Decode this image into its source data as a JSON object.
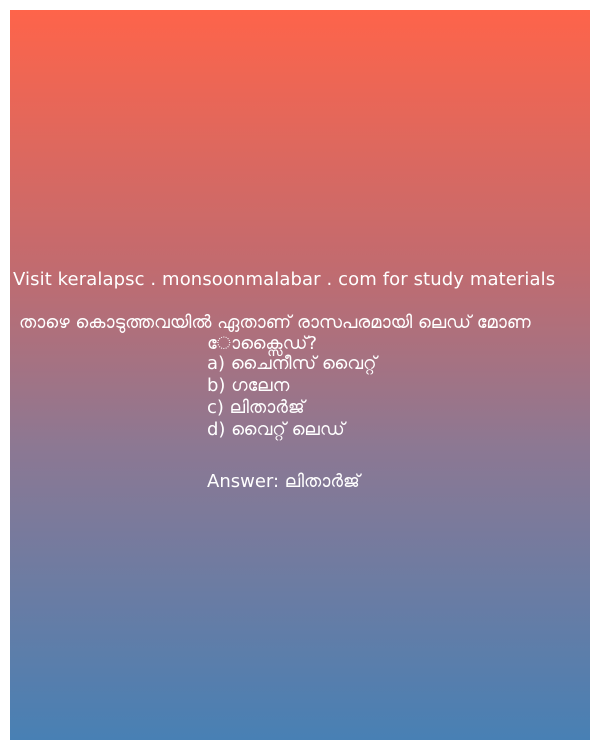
{
  "site_line": "Visit keralapsc . monsoonmalabar . com for study materials",
  "question": {
    "line1": "താഴെ കൊടുത്തവയിൽ  ഏതാണ് രാസപരമായി ലെഡ് മോണ",
    "line2": "ോക്സൈഡ്?"
  },
  "options": [
    "a) ചൈനീസ് വൈറ്റ്",
    "b) ഗലേന",
    "c) ലിതാർജ്",
    "d) വൈറ്റ് ലെഡ്"
  ],
  "answer": "Answer: ലിതാർജ്",
  "colors": {
    "gradient_top": "#fe644a",
    "gradient_bottom": "#4880b4",
    "text": "#ffffff"
  }
}
